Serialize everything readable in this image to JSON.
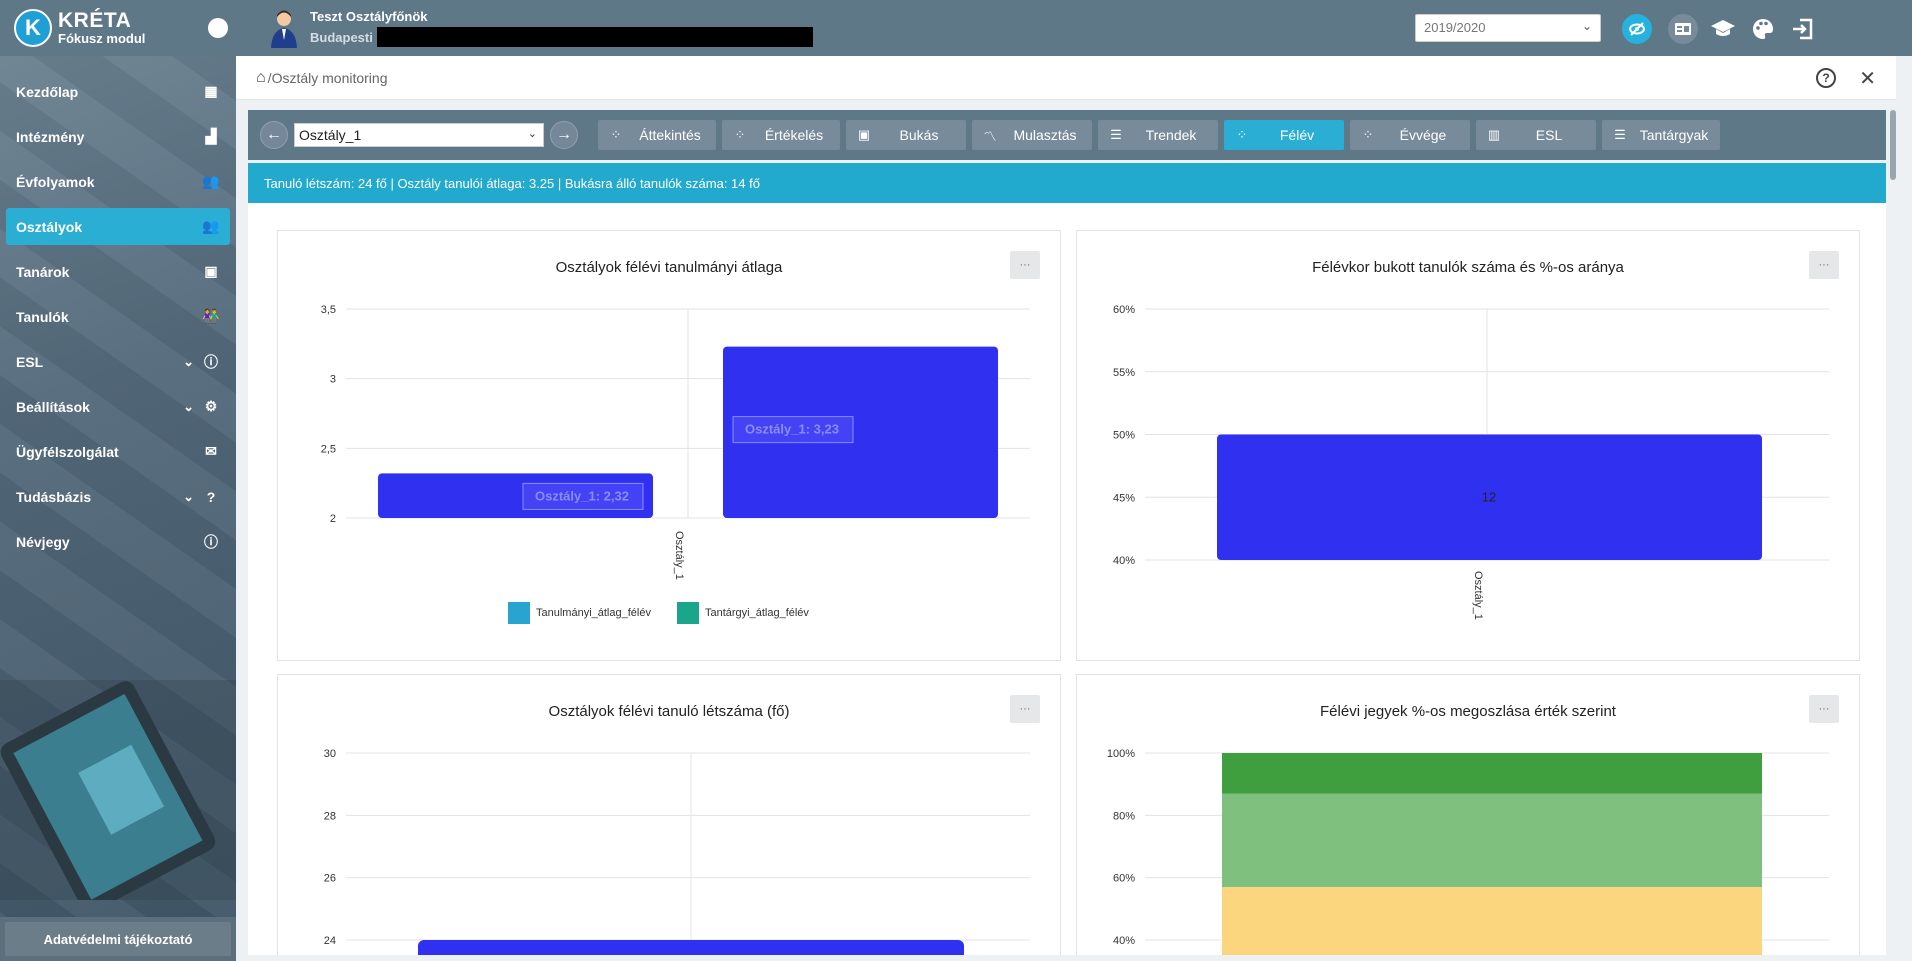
{
  "app": {
    "logo_letter": "K",
    "title": "KRÉTA",
    "subtitle": "Fókusz modul",
    "privacy_label": "Adatvédelmi tájékoztató"
  },
  "sidebar": {
    "items": [
      {
        "label": "Kezdőlap",
        "icon": "dashboard-icon",
        "glyph": "▦"
      },
      {
        "label": "Intézmény",
        "icon": "building-icon",
        "glyph": "▟"
      },
      {
        "label": "Évfolyamok",
        "icon": "people-icon",
        "glyph": "👥"
      },
      {
        "label": "Osztályok",
        "icon": "people-icon",
        "glyph": "👥"
      },
      {
        "label": "Tanárok",
        "icon": "contact-card-icon",
        "glyph": "▣"
      },
      {
        "label": "Tanulók",
        "icon": "students-icon",
        "glyph": "👫"
      },
      {
        "label": "ESL",
        "icon": "info-icon",
        "glyph": "ⓘ"
      },
      {
        "label": "Beállítások",
        "icon": "gear-icon",
        "glyph": "⚙"
      },
      {
        "label": "Ügyfélszolgálat",
        "icon": "mail-icon",
        "glyph": "✉"
      },
      {
        "label": "Tudásbázis",
        "icon": "help-icon",
        "glyph": "?"
      },
      {
        "label": "Névjegy",
        "icon": "info-icon",
        "glyph": "ⓘ"
      }
    ]
  },
  "topbar": {
    "user_name": "Teszt Osztályfőnök",
    "school": "Budapesti",
    "year": "2019/2020"
  },
  "breadcrumb": {
    "separator": "/",
    "page": "Osztály monitoring"
  },
  "toolbar": {
    "class_value": "Osztály_1",
    "tabs": [
      {
        "label": "Áttekintés",
        "icon": "dots-icon"
      },
      {
        "label": "Értékelés",
        "icon": "dots-icon"
      },
      {
        "label": "Bukás",
        "icon": "contact-icon"
      },
      {
        "label": "Mulasztás",
        "icon": "trend-icon"
      },
      {
        "label": "Trendek",
        "icon": "list-icon"
      },
      {
        "label": "Félév",
        "icon": "dots-icon"
      },
      {
        "label": "Évvége",
        "icon": "dots-icon"
      },
      {
        "label": "ESL",
        "icon": "bar-chart-icon"
      },
      {
        "label": "Tantárgyak",
        "icon": "list-icon"
      }
    ],
    "active_tab": "Félév"
  },
  "info": {
    "text": "Tanuló létszám: 24 fő | Osztály tanulói átlaga: 3.25 | Bukásra álló tanulók száma: 14 fő"
  },
  "card_menu_label": "···",
  "chart_data": [
    {
      "type": "bar",
      "title": "Osztályok félévi tanulmányi átlaga",
      "categories": [
        "Osztály_1"
      ],
      "series": [
        {
          "name": "Tanulmányi_átlag_félév",
          "values": [
            2.32
          ],
          "color": "#3030f0",
          "tooltip": "Osztály_1: 2,32"
        },
        {
          "name": "Tantárgyi_átlag_félév",
          "values": [
            3.23
          ],
          "color": "#3030f0",
          "tooltip": "Osztály_1: 3,23"
        }
      ],
      "legend": [
        {
          "name": "Tanulmányi_átlag_félév",
          "color": "#29a3d0"
        },
        {
          "name": "Tantárgyi_átlag_félév",
          "color": "#1aa68a"
        }
      ],
      "ylim": [
        2,
        3.5
      ],
      "yticks": [
        "2",
        "2,5",
        "3",
        "3,5"
      ],
      "legend_position": "bottom",
      "grid": true
    },
    {
      "type": "bar",
      "title": "Félévkor bukott tanulók száma és %-os aránya",
      "categories": [
        "Osztály_1"
      ],
      "values": [
        50
      ],
      "data_label": "12",
      "ylim": [
        40,
        60
      ],
      "yticks": [
        "40%",
        "45%",
        "50%",
        "55%",
        "60%"
      ],
      "color": "#3030f0",
      "grid": true
    },
    {
      "type": "bar",
      "title": "Osztályok félévi tanuló létszáma (fő)",
      "categories": [
        "Osztály_1"
      ],
      "values": [
        24
      ],
      "ylim": [
        24,
        30
      ],
      "yticks": [
        "24",
        "26",
        "28",
        "30"
      ],
      "color": "#3030f0",
      "grid": true
    },
    {
      "type": "bar",
      "title": "Félévi jegyek %-os megoszlása érték szerint",
      "categories": [
        ""
      ],
      "stacked": true,
      "segments": [
        {
          "from": 40,
          "to": 57,
          "color": "#fcd57f"
        },
        {
          "from": 57,
          "to": 87,
          "color": "#7fc07e"
        },
        {
          "from": 87,
          "to": 100,
          "color": "#3f9f3e"
        }
      ],
      "ylim": [
        40,
        100
      ],
      "yticks": [
        "40%",
        "60%",
        "80%",
        "100%"
      ],
      "grid": true
    }
  ]
}
